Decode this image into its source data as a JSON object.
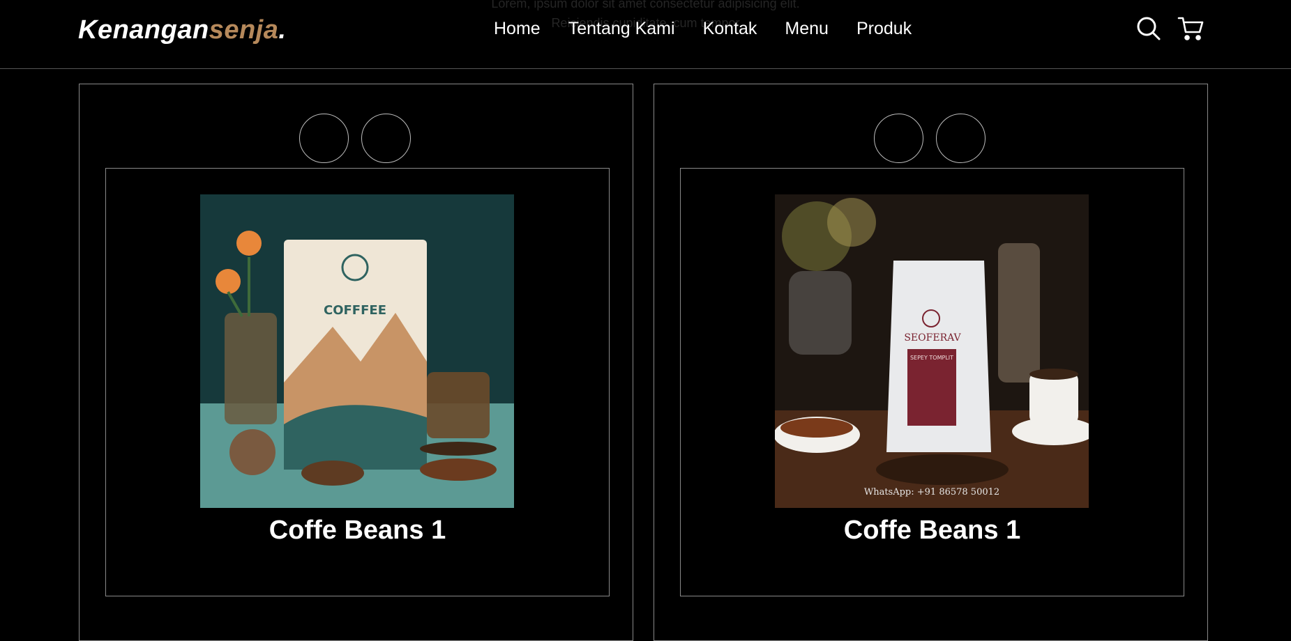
{
  "background": {
    "line1": "Lorem, ipsum dolor sit amet consectetur adipisicing elit.",
    "line2": "Reiciendis cupiditate, cum tempor"
  },
  "header": {
    "logo": {
      "part1": "Kenangan",
      "part2": "senja",
      "dot": "."
    },
    "nav": [
      "Home",
      "Tentang Kami",
      "Kontak",
      "Menu",
      "Produk"
    ],
    "icons": [
      "search-icon",
      "cart-icon"
    ]
  },
  "products": [
    {
      "title": "Coffe Beans 1",
      "package_text": "COFFFEE",
      "colors": {
        "bg": "#1f4a4a",
        "bag": "#efe6d6",
        "accent": "#b07a4a"
      }
    },
    {
      "title": "Coffe Beans 1",
      "package_brand": "SEOFERAV",
      "package_label": "SEPEY TOMPLIT",
      "photo_caption": "WhatsApp: +91 86578 50012",
      "colors": {
        "bg": "#2a1e16",
        "bag": "#e9eaec",
        "accent": "#7a2330"
      }
    }
  ],
  "colors": {
    "accent": "#b6895b",
    "background": "#000000",
    "border": "#8a8a8a"
  }
}
